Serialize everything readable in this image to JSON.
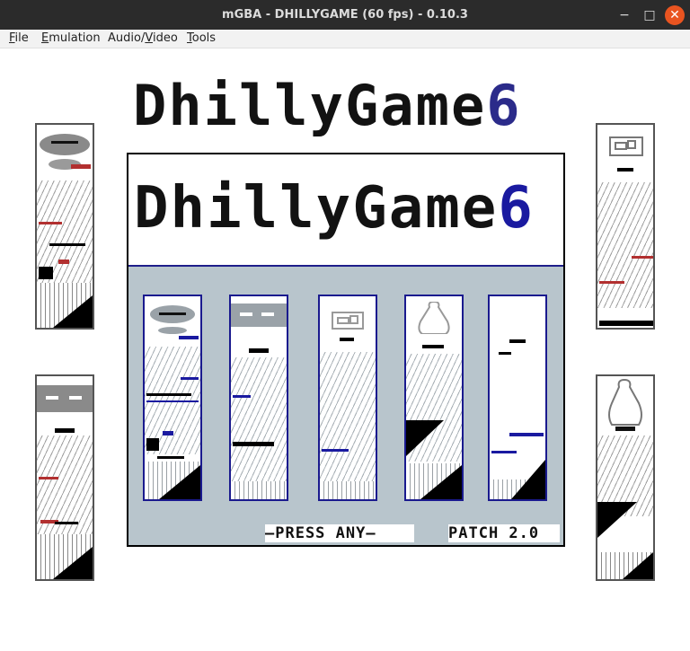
{
  "window": {
    "title": "mGBA - DHILLYGAME (60 fps) - 0.10.3",
    "min_glyph": "−",
    "max_glyph": "□",
    "close_glyph": "✕"
  },
  "menu": {
    "items": [
      {
        "label": "File",
        "accel": "F",
        "rest": "ile"
      },
      {
        "label": "Emulation",
        "accel": "E",
        "rest": "mulation"
      },
      {
        "label": "Audio/Video",
        "pre": "Audio/",
        "accel": "V",
        "rest": "ideo"
      },
      {
        "label": "Tools",
        "accel": "T",
        "rest": "ools"
      }
    ]
  },
  "game": {
    "logo_word": "DhillyGame",
    "logo_number": "6",
    "press_any": "–PRESS ANY–",
    "patch": "PATCH 2.0",
    "colors": {
      "frame_bg": "#b8c5cc",
      "card_border": "#1a1a8e",
      "accent_blue": "#1a1aa0"
    }
  }
}
